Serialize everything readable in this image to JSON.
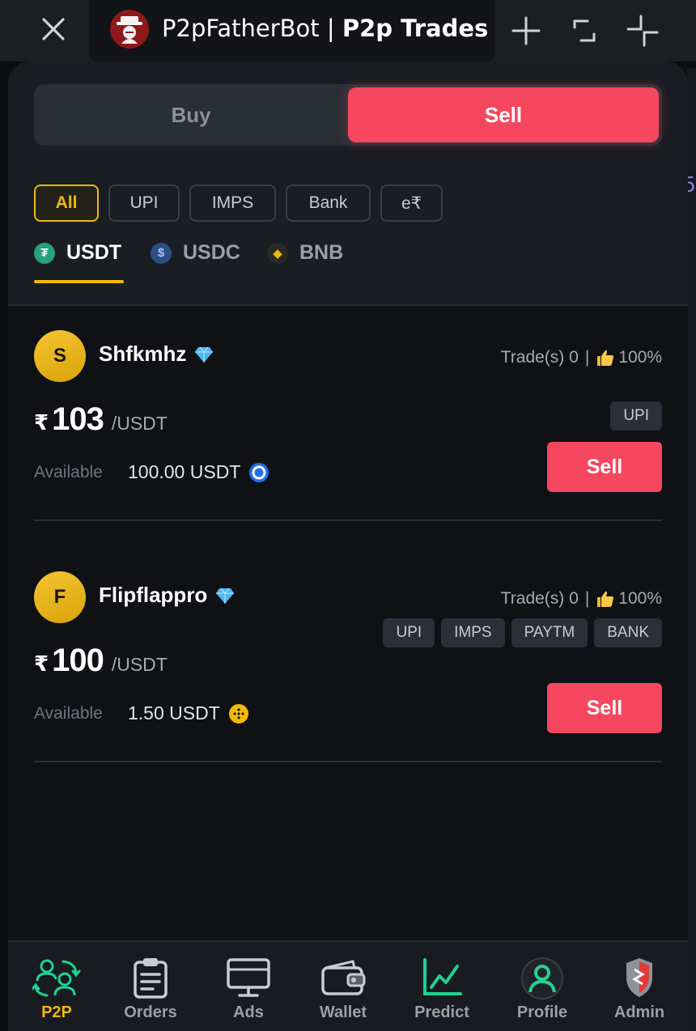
{
  "titlebar": {
    "bot_name": "P2pFatherBot |",
    "page_name": "P2p Trades"
  },
  "mode_toggle": {
    "buy_label": "Buy",
    "sell_label": "Sell",
    "selected": "Sell"
  },
  "payment_filters": [
    {
      "label": "All",
      "active": true
    },
    {
      "label": "UPI",
      "active": false
    },
    {
      "label": "IMPS",
      "active": false
    },
    {
      "label": "Bank",
      "active": false
    },
    {
      "label": "e₹",
      "active": false
    }
  ],
  "coins": [
    {
      "label": "USDT",
      "active": true,
      "icon": "tether-icon",
      "color": "#26a17b"
    },
    {
      "label": "USDC",
      "active": false,
      "icon": "usdc-icon",
      "color": "#2775ca"
    },
    {
      "label": "BNB",
      "active": false,
      "icon": "bnb-icon",
      "color": "#f0b90b"
    }
  ],
  "offers": [
    {
      "avatar_letter": "S",
      "username": "Shfkmhz",
      "trades_label": "Trade(s) 0",
      "rating": "100%",
      "currency_symbol": "₹",
      "price": "103",
      "unit": "/USDT",
      "available_label": "Available",
      "available_amount": "100.00 USDT",
      "network_icon": "ton-circle-icon",
      "payment_tags": [
        "UPI"
      ],
      "action_label": "Sell"
    },
    {
      "avatar_letter": "F",
      "username": "Flipflappro",
      "trades_label": "Trade(s) 0",
      "rating": "100%",
      "currency_symbol": "₹",
      "price": "100",
      "unit": "/USDT",
      "available_label": "Available",
      "available_amount": "1.50 USDT",
      "network_icon": "bnb-icon",
      "payment_tags": [
        "UPI",
        "IMPS",
        "PAYTM",
        "BANK"
      ],
      "action_label": "Sell"
    }
  ],
  "nav": [
    {
      "label": "P2P",
      "icon": "p2p-exchange-icon",
      "active": true
    },
    {
      "label": "Orders",
      "icon": "clipboard-icon",
      "active": false
    },
    {
      "label": "Ads",
      "icon": "monitor-icon",
      "active": false
    },
    {
      "label": "Wallet",
      "icon": "wallet-icon",
      "active": false
    },
    {
      "label": "Predict",
      "icon": "chart-line-icon",
      "active": false
    },
    {
      "label": "Profile",
      "icon": "user-circle-icon",
      "active": false
    },
    {
      "label": "Admin",
      "icon": "shield-icon",
      "active": false
    }
  ],
  "colors": {
    "accent": "#f5475f",
    "highlight": "#f0b90b",
    "green": "#1fd28f"
  }
}
